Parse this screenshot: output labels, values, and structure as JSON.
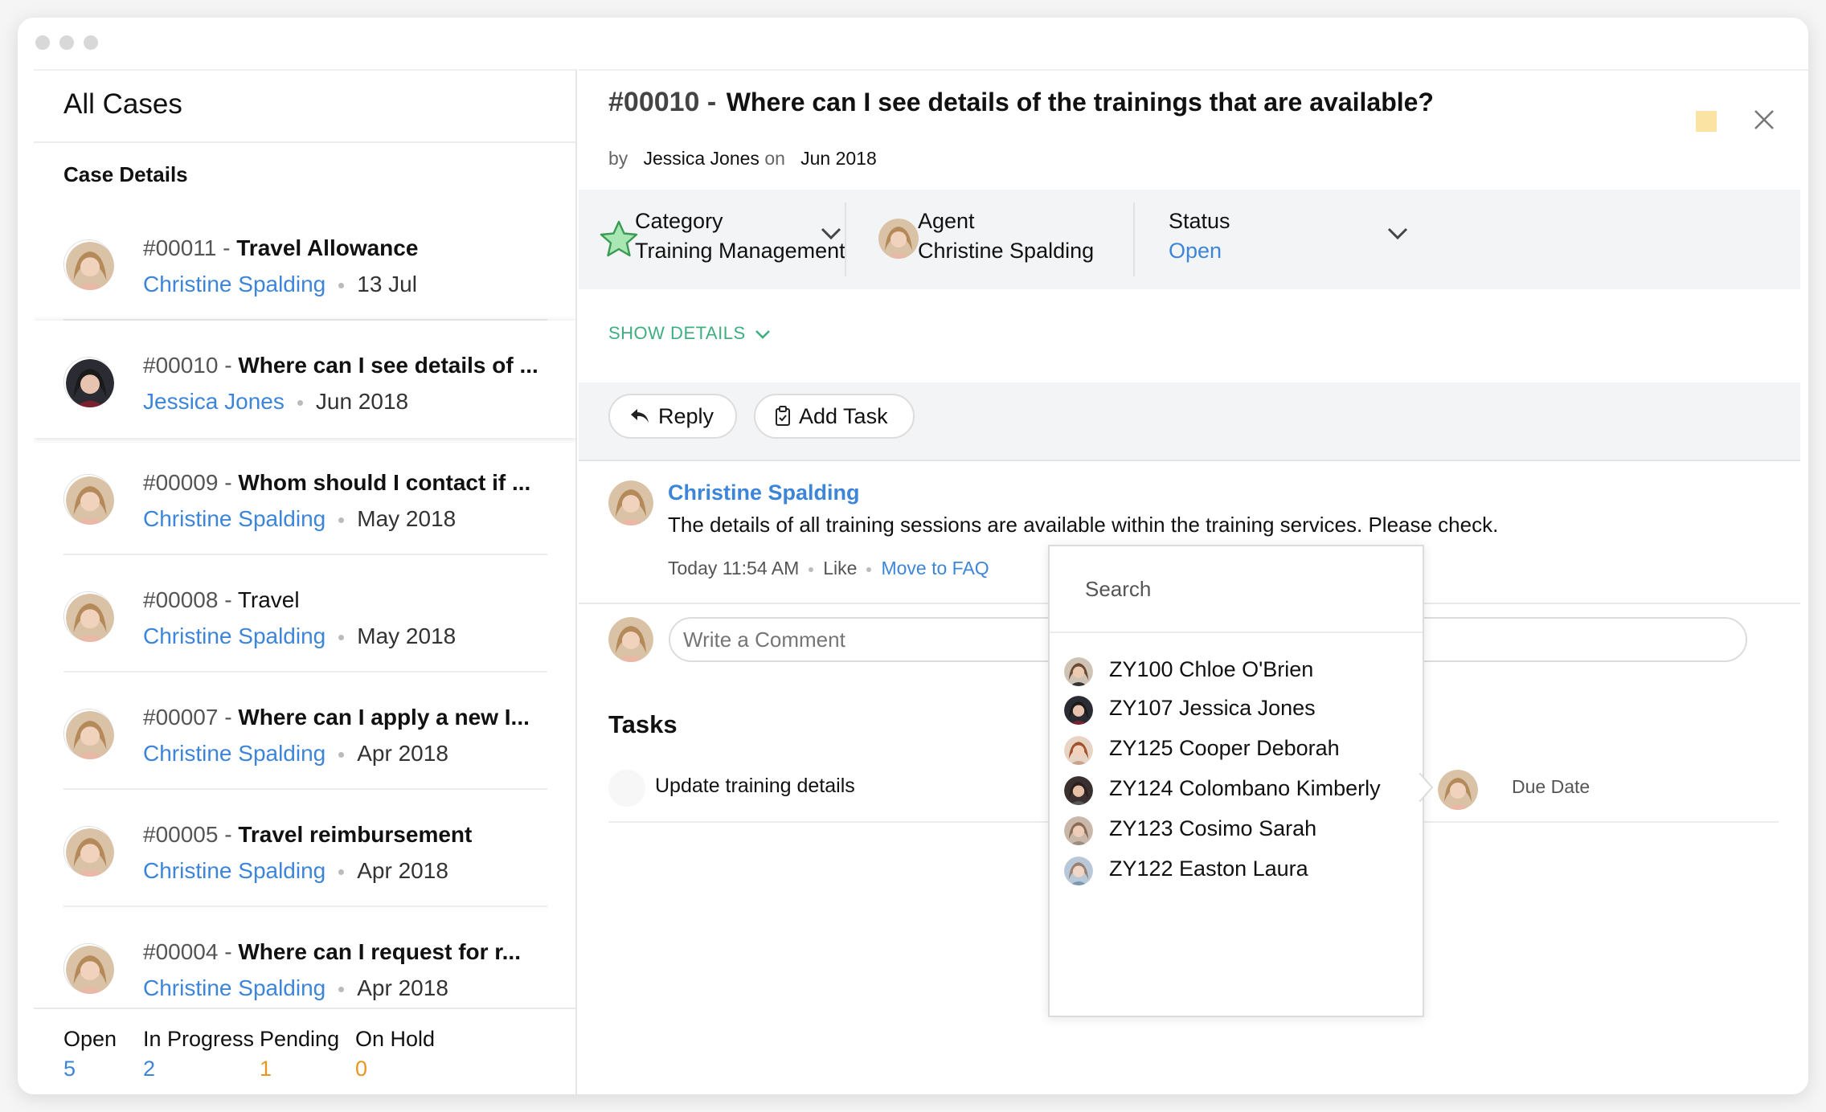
{
  "left_pane": {
    "title": "All Cases",
    "section_label": "Case Details",
    "cases": [
      {
        "num": "#00011",
        "sep": "-",
        "subject": "Travel Allowance",
        "agent": "Christine Spalding",
        "date": "13 Jul",
        "avatar": "christine"
      },
      {
        "num": "#00010",
        "sep": "-",
        "subject": "Where can I see details of ...",
        "agent": "Jessica Jones",
        "date": "Jun 2018",
        "avatar": "jessica",
        "active": true
      },
      {
        "num": "#00009",
        "sep": "-",
        "subject": "Whom should I contact if ...",
        "agent": "Christine Spalding",
        "date": "May 2018",
        "avatar": "christine"
      },
      {
        "num": "#00008",
        "sep": "-",
        "subject": "Travel",
        "agent": "Christine Spalding",
        "date": "May 2018",
        "avatar": "christine",
        "subject_regular": true
      },
      {
        "num": "#00007",
        "sep": "-",
        "subject": "Where can I apply a new I...",
        "agent": "Christine Spalding",
        "date": "Apr 2018",
        "avatar": "christine"
      },
      {
        "num": "#00005",
        "sep": "-",
        "subject": "Travel reimbursement",
        "agent": "Christine Spalding",
        "date": "Apr 2018",
        "avatar": "christine"
      },
      {
        "num": "#00004",
        "sep": "-",
        "subject": "Where can I request for r...",
        "agent": "Christine Spalding",
        "date": "Apr 2018",
        "avatar": "christine"
      }
    ],
    "status_counts": [
      {
        "label": "Open",
        "value": "5",
        "color": "#3d85d8"
      },
      {
        "label": "In Progress",
        "value": "2",
        "color": "#3d85d8"
      },
      {
        "label": "Pending",
        "value": "1",
        "color": "#e8961e"
      },
      {
        "label": "On Hold",
        "value": "0",
        "color": "#e8961e"
      }
    ]
  },
  "ticket": {
    "number": "#00010 -",
    "subject": "Where can I see details of the trainings that are available?",
    "by_label": "by",
    "author": "Jessica Jones",
    "on_label": "on",
    "date": "Jun 2018",
    "category_label": "Category",
    "category_value": "Training Management",
    "agent_label": "Agent",
    "agent_value": "Christine Spalding",
    "status_label": "Status",
    "status_value": "Open",
    "show_details": "SHOW DETAILS",
    "reply_label": "Reply",
    "add_task_label": "Add Task"
  },
  "comment": {
    "author": "Christine Spalding",
    "text": "The details of all training sessions are available within the training services. Please check.",
    "time": "Today 11:54 AM",
    "like": "Like",
    "move_faq": "Move to FAQ"
  },
  "write_comment": {
    "placeholder": "Write a Comment"
  },
  "tasks": {
    "title": "Tasks",
    "items": [
      {
        "label": "Update training details",
        "due": "Due Date"
      }
    ]
  },
  "dropdown": {
    "search_placeholder": "Search",
    "items": [
      {
        "label": "ZY100 Chloe O'Brien",
        "avatar": "chloe"
      },
      {
        "label": "ZY107 Jessica Jones",
        "avatar": "jessica"
      },
      {
        "label": "ZY125 Cooper Deborah",
        "avatar": "deborah"
      },
      {
        "label": "ZY124 Colombano Kimberly",
        "avatar": "kimberly"
      },
      {
        "label": "ZY123 Cosimo Sarah",
        "avatar": "sarah"
      },
      {
        "label": "ZY122 Easton Laura",
        "avatar": "laura"
      }
    ]
  },
  "colors": {
    "accent_blue": "#3d85d8",
    "accent_green": "#3fae80",
    "accent_orange": "#e8961e",
    "panel_gray": "#f3f4f5"
  },
  "icons": [
    "star-icon",
    "chevron-down-icon",
    "reply-icon",
    "clipboard-icon",
    "close-icon",
    "note-icon"
  ]
}
